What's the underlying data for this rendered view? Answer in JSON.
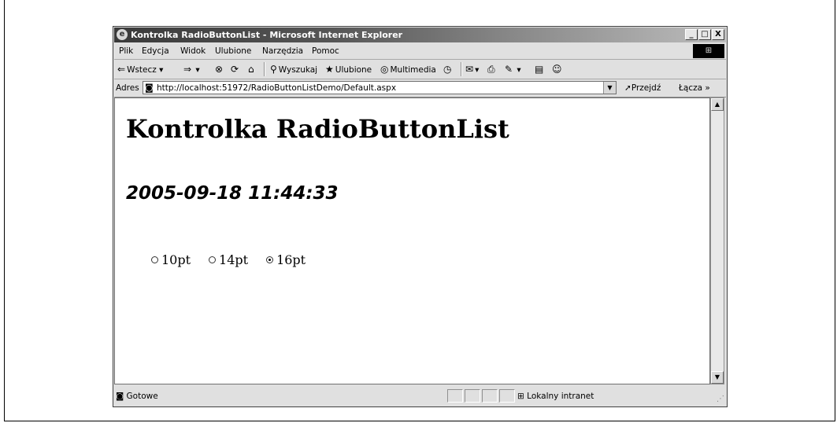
{
  "window": {
    "title": "Kontrolka RadioButtonList - Microsoft Internet Explorer",
    "minimize": "_",
    "maximize": "□",
    "close": "X"
  },
  "menu": {
    "items": [
      "Plik",
      "Edycja",
      "Widok",
      "Ulubione",
      "Narzędzia",
      "Pomoc"
    ]
  },
  "toolbar": {
    "back": "Wstecz",
    "search": "Wyszukaj",
    "favorites": "Ulubione",
    "multimedia": "Multimedia"
  },
  "address": {
    "label": "Adres",
    "url": "http://localhost:51972/RadioButtonListDemo/Default.aspx",
    "go": "Przejdź",
    "links": "Łącza"
  },
  "page": {
    "heading": "Kontrolka RadioButtonList",
    "timestamp": "2005-09-18 11:44:33",
    "options": [
      {
        "label": "10pt",
        "checked": false
      },
      {
        "label": "14pt",
        "checked": false
      },
      {
        "label": "16pt",
        "checked": true
      }
    ]
  },
  "status": {
    "text": "Gotowe",
    "zone": "Lokalny intranet"
  }
}
